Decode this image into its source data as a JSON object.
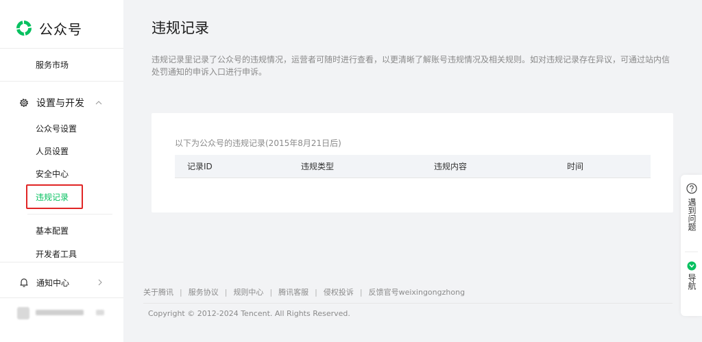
{
  "brand": {
    "name": "公众号",
    "logo_icon": "wechat-official-account-logo",
    "color": "#07c160"
  },
  "sidebar": {
    "service_market": "服务市场",
    "settings_section": {
      "label": "设置与开发",
      "icon": "gear-icon",
      "expanded": true
    },
    "settings_items": [
      {
        "label": "公众号设置",
        "active": false
      },
      {
        "label": "人员设置",
        "active": false
      },
      {
        "label": "安全中心",
        "active": false
      },
      {
        "label": "违规记录",
        "active": true
      }
    ],
    "dev_items": [
      {
        "label": "基本配置"
      },
      {
        "label": "开发者工具"
      }
    ],
    "notification_section": {
      "label": "通知中心",
      "icon": "bell-icon"
    },
    "active_color": "#07c160",
    "highlight_color": "#e02424"
  },
  "main": {
    "title": "违规记录",
    "description": "违规记录里记录了公众号的违规情况，运营者可随时进行查看，以更清晰了解账号违规情况及相关规则。如对违规记录存在异议，可通过站内信处罚通知的申诉入口进行申诉。",
    "record_note": "以下为公众号的违规记录(2015年8月21日后)",
    "table_headers": [
      "记录ID",
      "违规类型",
      "违规内容",
      "时间"
    ]
  },
  "footer": {
    "links": [
      "关于腾讯",
      "服务协议",
      "规则中心",
      "腾讯客服",
      "侵权投诉",
      "反馈官号weixingongzhong"
    ],
    "copyright": "Copyright © 2012-2024 Tencent. All Rights Reserved."
  },
  "float_panel": {
    "help": {
      "label": "遇到问题",
      "icon": "question-circle-icon"
    },
    "nav": {
      "label": "导航",
      "icon": "green-badge-icon"
    }
  }
}
